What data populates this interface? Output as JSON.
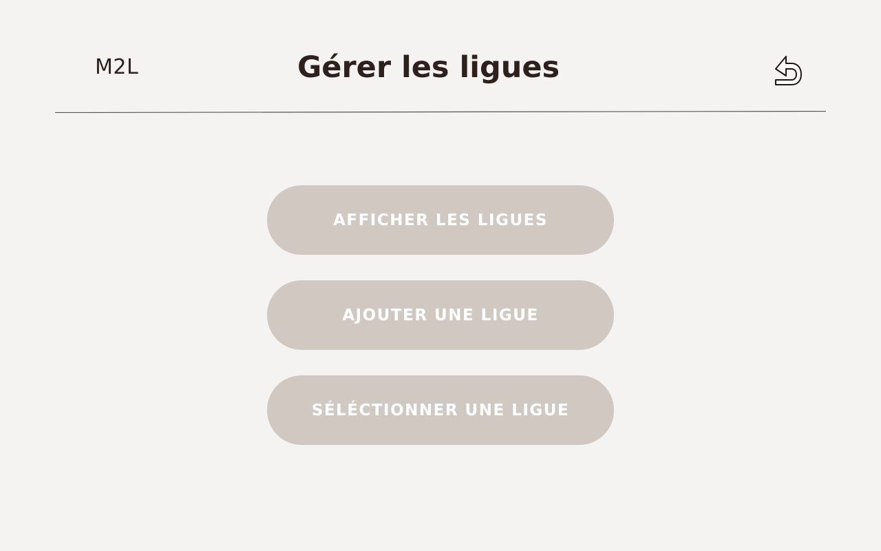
{
  "header": {
    "brand": "M2L",
    "title": "Gérer les ligues",
    "back_icon": "undo-arrow-icon"
  },
  "menu": {
    "items": [
      {
        "label": "AFFICHER LES LIGUES"
      },
      {
        "label": "AJOUTER UNE LIGUE"
      },
      {
        "label": "SÉLÉCTIONNER UNE LIGUE"
      }
    ]
  },
  "colors": {
    "background": "#f4f3f1",
    "text_dark": "#2e211d",
    "button_bg": "#d1c8c2",
    "button_text": "#ffffff",
    "divider": "#555555"
  }
}
